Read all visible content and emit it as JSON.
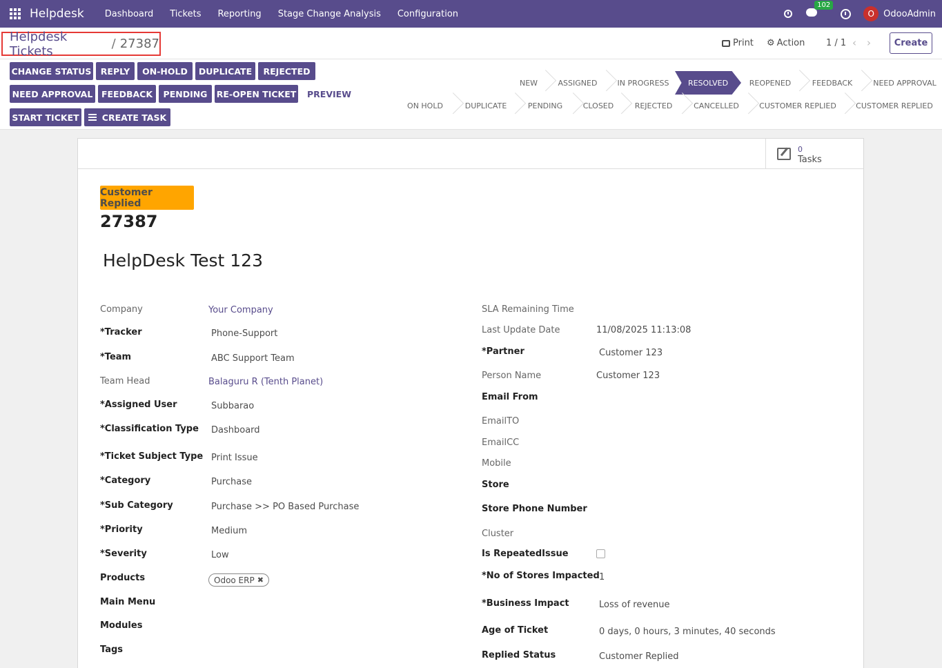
{
  "navbar": {
    "brand": "Helpdesk",
    "menu": [
      "Dashboard",
      "Tickets",
      "Reporting",
      "Stage Change Analysis",
      "Configuration"
    ],
    "chat_count": "102",
    "avatar_letter": "O",
    "user": "OdooAdmin"
  },
  "control": {
    "breadcrumb_parent": "Helpdesk Tickets",
    "breadcrumb_sep": "/",
    "breadcrumb_current": "27387",
    "print": "Print",
    "action": "Action",
    "pager": "1 / 1",
    "create": "Create"
  },
  "header_buttons": {
    "change_status": "CHANGE STATUS",
    "reply": "REPLY",
    "on_hold": "ON-HOLD",
    "duplicate": "DUPLICATE",
    "rejected": "REJECTED",
    "need_approval": "NEED APPROVAL",
    "feedback": "FEEDBACK",
    "pending": "PENDING",
    "reopen": "RE-OPEN TICKET",
    "preview": "PREVIEW",
    "start_ticket": "START TICKET",
    "create_task": "CREATE TASK"
  },
  "stages_row1": [
    "NEW",
    "ASSIGNED",
    "IN PROGRESS",
    "RESOLVED",
    "REOPENED",
    "FEEDBACK",
    "NEED APPROVAL"
  ],
  "stages_row2": [
    "ON HOLD",
    "DUPLICATE",
    "PENDING",
    "CLOSED",
    "REJECTED",
    "CANCELLED",
    "CUSTOMER REPLIED",
    "CUSTOMER REPLIED"
  ],
  "active_stage": "RESOLVED",
  "colors": {
    "brand": "#584c8c",
    "badge": "#ffa500",
    "highlight": "#e53935"
  },
  "stat": {
    "tasks_value": "0",
    "tasks_label": "Tasks"
  },
  "ticket": {
    "status": "Customer Replied",
    "number": "27387",
    "name": "HelpDesk Test 123"
  },
  "left_fields": {
    "company_label": "Company",
    "company": "Your Company",
    "tracker_label": "*Tracker",
    "tracker": "Phone-Support",
    "team_label": "*Team",
    "team": "ABC Support Team",
    "team_head_label": "Team Head",
    "team_head": "Balaguru R (Tenth Planet)",
    "assigned_user_label": "*Assigned User",
    "assigned_user": "Subbarao",
    "classification_label": "*Classification Type",
    "classification": "Dashboard",
    "subject_type_label": "*Ticket Subject Type",
    "subject_type": "Print Issue",
    "category_label": "*Category",
    "category": "Purchase",
    "sub_category_label": "*Sub Category",
    "sub_category": "Purchase >> PO Based Purchase",
    "priority_label": "*Priority",
    "priority": "Medium",
    "severity_label": "*Severity",
    "severity": "Low",
    "products_label": "Products",
    "product_tag": "Odoo ERP",
    "main_menu_label": "Main Menu",
    "modules_label": "Modules",
    "tags_label": "Tags"
  },
  "right_fields": {
    "sla_label": "SLA Remaining Time",
    "last_update_label": "Last Update Date",
    "last_update": "11/08/2025 11:13:08",
    "partner_label": "*Partner",
    "partner": "Customer 123",
    "person_name_label": "Person Name",
    "person_name": "Customer 123",
    "email_from_label": "Email From",
    "email_to_label": "EmailTO",
    "email_cc_label": "EmailCC",
    "mobile_label": "Mobile",
    "store_label": "Store",
    "store_phone_label": "Store Phone Number",
    "cluster_label": "Cluster",
    "repeated_label": "Is RepeatedIssue",
    "stores_impacted_label": "*No of Stores Impacted",
    "stores_impacted": "1",
    "business_impact_label": "*Business Impact",
    "business_impact": "Loss of revenue",
    "age_label": "Age of Ticket",
    "age": "0 days, 0 hours, 3 minutes, 40 seconds",
    "replied_status_label": "Replied Status",
    "replied_status": "Customer Replied"
  }
}
